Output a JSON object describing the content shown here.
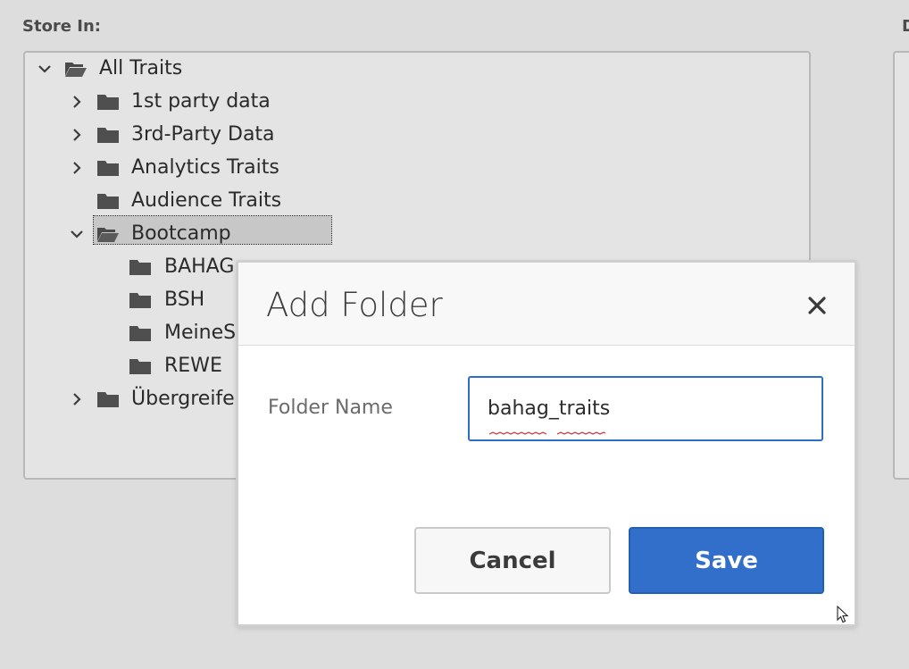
{
  "labels": {
    "store_in": "Store In:",
    "right_label": "D"
  },
  "tree": {
    "root": {
      "label": "All Traits",
      "icon": "folder-open-icon",
      "expanded": true
    },
    "items": [
      {
        "label": "1st party data",
        "icon": "folder-icon",
        "has_children": true,
        "expanded": false
      },
      {
        "label": "3rd-Party Data",
        "icon": "folder-icon",
        "has_children": true,
        "expanded": false
      },
      {
        "label": "Analytics Traits",
        "icon": "folder-icon",
        "has_children": true,
        "expanded": false
      },
      {
        "label": "Audience Traits",
        "icon": "folder-icon",
        "has_children": false,
        "expanded": false
      },
      {
        "label": "Bootcamp",
        "icon": "folder-open-icon",
        "has_children": true,
        "expanded": true,
        "selected": true
      },
      {
        "label": "BAHAG",
        "icon": "folder-icon",
        "has_children": false
      },
      {
        "label": "BSH",
        "icon": "folder-icon",
        "has_children": false
      },
      {
        "label": "MeineS",
        "icon": "folder-icon",
        "has_children": false
      },
      {
        "label": "REWE",
        "icon": "folder-icon",
        "has_children": false
      },
      {
        "label": "Übergreifen",
        "icon": "folder-icon",
        "has_children": true,
        "expanded": false
      }
    ]
  },
  "dialog": {
    "title": "Add Folder",
    "close_icon": "close-icon",
    "field_label": "Folder Name",
    "field_value": "bahag_traits",
    "cancel_label": "Cancel",
    "save_label": "Save"
  },
  "colors": {
    "accent": "#326fcb",
    "background": "#dddddd",
    "panel": "#e4e4e4",
    "selection": "#c7c7c7"
  }
}
